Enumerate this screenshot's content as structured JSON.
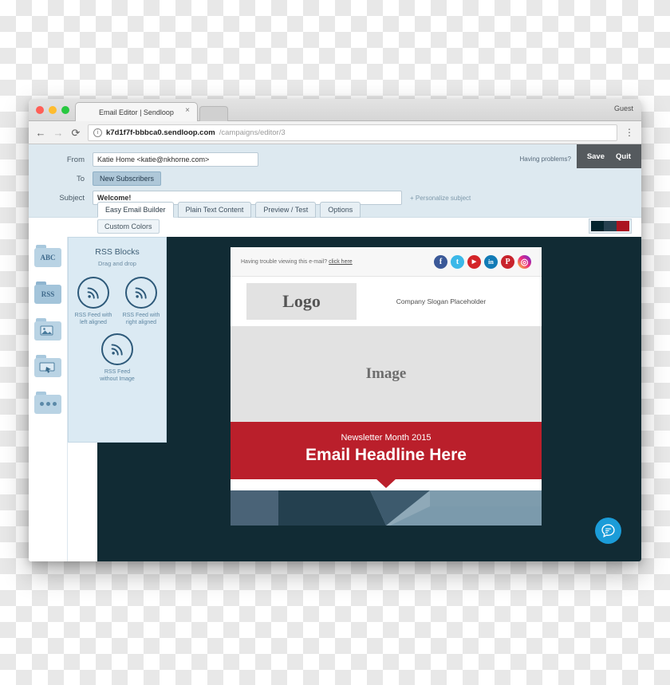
{
  "browser": {
    "tab_title": "Email Editor | Sendloop",
    "tab_close": "×",
    "back_icon": "←",
    "forward_icon": "→",
    "reload_icon": "⟳",
    "info_icon": "i",
    "url_host": "k7d1f7f-bbbca0.sendloop.com",
    "url_path": "/campaigns/editor/3",
    "menu_icon": "⋮",
    "profile_label": "Guest"
  },
  "header": {
    "from_label": "From",
    "from_value": "Katie Home <katie@nkhorne.com>",
    "to_label": "To",
    "to_value": "New Subscribers",
    "subject_label": "Subject",
    "subject_value": "Welcome!",
    "personalize_link": "+ Personalize subject",
    "having_problems": "Having problems?",
    "save_label": "Save",
    "quit_label": "Quit",
    "tabs": [
      {
        "label": "Easy Email Builder",
        "active": true
      },
      {
        "label": "Plain Text Content",
        "active": false
      },
      {
        "label": "Preview / Test",
        "active": false
      },
      {
        "label": "Options",
        "active": false
      }
    ],
    "custom_colors_label": "Custom Colors",
    "swatches": [
      "#04242c",
      "#27414f",
      "#ab1420"
    ]
  },
  "rail": {
    "items": [
      {
        "name": "text-blocks",
        "glyph": "ABC",
        "active": false
      },
      {
        "name": "rss-blocks",
        "glyph": "RSS",
        "active": true
      },
      {
        "name": "image-blocks",
        "glyph": "❑",
        "active": false
      },
      {
        "name": "button-blocks",
        "glyph": "▣",
        "active": false
      },
      {
        "name": "more-blocks",
        "glyph": "•••",
        "active": false
      }
    ]
  },
  "rss_panel": {
    "title": "RSS Blocks",
    "subtitle": "Drag and drop",
    "blocks": [
      {
        "label": "RSS Feed with left aligned"
      },
      {
        "label": "RSS Feed with right aligned"
      },
      {
        "label": "RSS Feed without Image"
      }
    ]
  },
  "email": {
    "trouble_text": "Having trouble viewing this e-mail?",
    "trouble_link": "click here",
    "socials": [
      {
        "name": "facebook",
        "glyph": "f"
      },
      {
        "name": "twitter",
        "glyph": "t"
      },
      {
        "name": "youtube",
        "glyph": "▶"
      },
      {
        "name": "linkedin",
        "glyph": "in"
      },
      {
        "name": "pinterest",
        "glyph": "P"
      },
      {
        "name": "instagram",
        "glyph": "◎"
      }
    ],
    "logo_text": "Logo",
    "slogan": "Company Slogan Placeholder",
    "image_placeholder": "Image",
    "banner_kicker": "Newsletter Month 2015",
    "banner_headline": "Email Headline Here",
    "banner_color": "#ba1f2b"
  },
  "fab": {
    "icon": "chat-icon"
  }
}
